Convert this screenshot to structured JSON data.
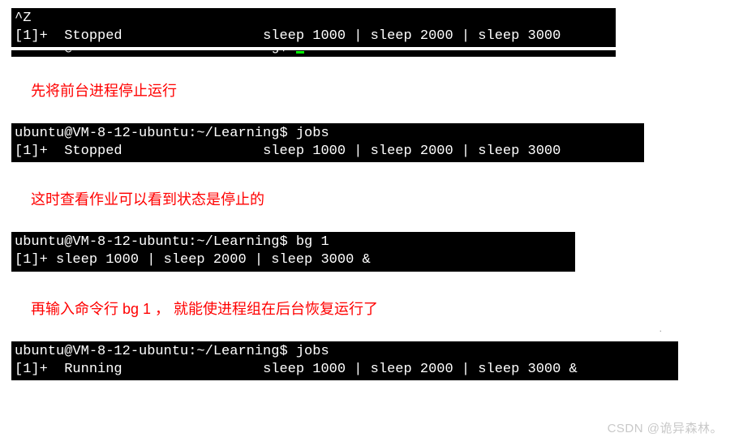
{
  "block1": {
    "line1": "^Z",
    "line2_left": "[1]+  Stopped",
    "line2_mid_space": "                 ",
    "line2_right": "sleep 1000 | sleep 2000 | sleep 3000"
  },
  "caption1": "先将前台进程停止运行",
  "block2": {
    "line1": "ubuntu@VM-8-12-ubuntu:~/Learning$ jobs",
    "line2_left": "[1]+  Stopped",
    "line2_mid_space": "                 ",
    "line2_right": "sleep 1000 | sleep 2000 | sleep 3000"
  },
  "caption2": "这时查看作业可以看到状态是停止的",
  "block3": {
    "line1": "ubuntu@VM-8-12-ubuntu:~/Learning$ bg 1",
    "line2": "[1]+ sleep 1000 | sleep 2000 | sleep 3000 &"
  },
  "caption3": "再输入命令行 bg 1 ， 就能使进程组在后台恢复运行了",
  "block4": {
    "line1": "ubuntu@VM-8-12-ubuntu:~/Learning$ jobs",
    "line2_left": "[1]+  Running",
    "line2_mid_space": "                 ",
    "line2_right": "sleep 1000 | sleep 2000 | sleep 3000 &"
  },
  "watermark": "CSDN @诡异森林。"
}
